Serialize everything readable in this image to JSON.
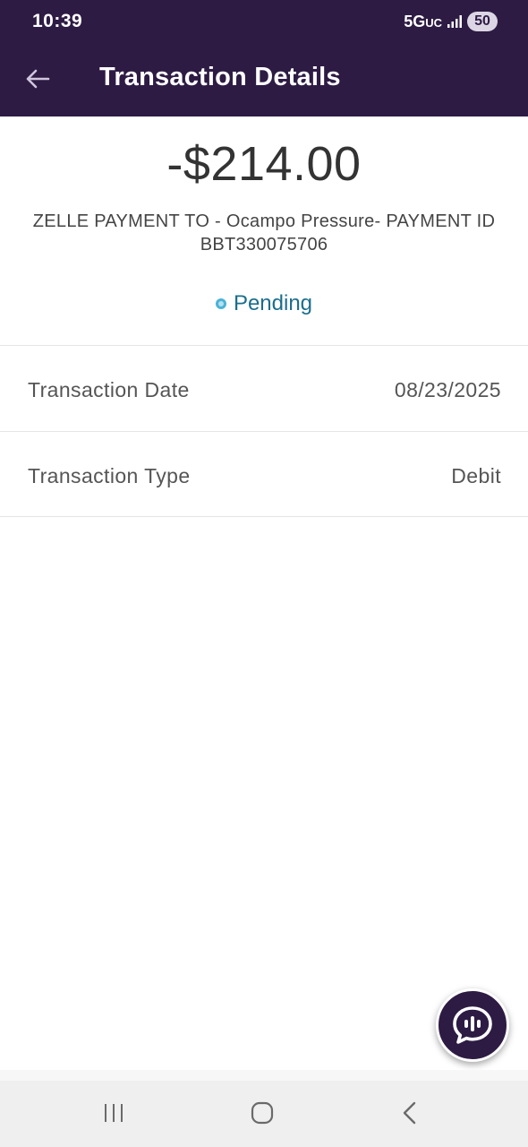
{
  "status_bar": {
    "time": "10:39",
    "network": "5G",
    "network_suffix": "UC",
    "battery": "50"
  },
  "header": {
    "title": "Transaction Details",
    "back_icon": "arrow-left-icon"
  },
  "transaction": {
    "amount": "-$214.00",
    "description": "ZELLE PAYMENT TO - Ocampo Pressure- PAYMENT ID BBT330075706",
    "status": "Pending",
    "status_color": "#4ab3d6",
    "details": [
      {
        "label": "Transaction Date",
        "value": "08/23/2025"
      },
      {
        "label": "Transaction Type",
        "value": "Debit"
      }
    ]
  },
  "chat_button": {
    "icon": "chat-bubble-icon"
  },
  "colors": {
    "header_bg": "#2d1b44",
    "status_text": "#1b6e8c"
  },
  "system_nav": {
    "recents_icon": "recents-icon",
    "home_icon": "home-icon",
    "back_icon": "back-chevron-icon"
  }
}
